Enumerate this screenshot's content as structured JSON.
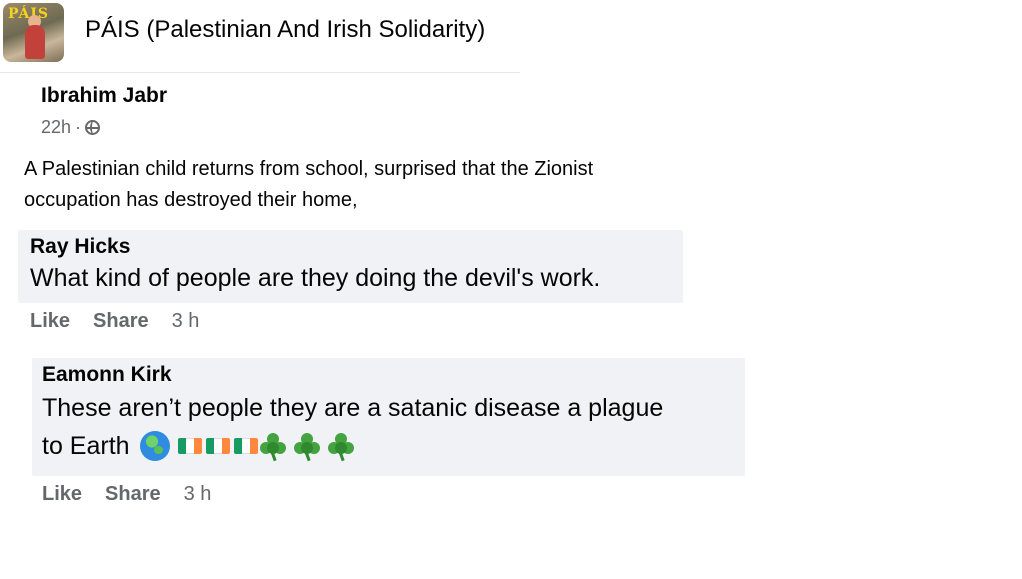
{
  "group": {
    "name": "PÁIS (Palestinian And Irish Solidarity)",
    "avatar_text": "PÁIS"
  },
  "post": {
    "author": "Ibrahim Jabr",
    "time": "22h",
    "separator": "·",
    "audience_icon": "globe-icon",
    "text_line1": "A Palestinian child returns from school, surprised that the Zionist",
    "text_line2": "occupation has destroyed their home,"
  },
  "comments": [
    {
      "author": "Ray Hicks",
      "text": "What kind of people are they doing the devil's work.",
      "like_label": "Like",
      "share_label": "Share",
      "time": "3 h"
    },
    {
      "author": "Eamonn Kirk",
      "text_line1": "These aren’t people they are a satanic disease a plague",
      "text_line2": "to Earth",
      "emoji": [
        "earth-icon",
        "ireland-flag-icon",
        "ireland-flag-icon",
        "ireland-flag-icon",
        "shamrock-icon",
        "shamrock-icon",
        "shamrock-icon"
      ],
      "like_label": "Like",
      "share_label": "Share",
      "time": "3 h"
    }
  ],
  "colors": {
    "bubble": "#f0f2f5",
    "secondary_text": "#65676b",
    "primary_text": "#050505"
  }
}
